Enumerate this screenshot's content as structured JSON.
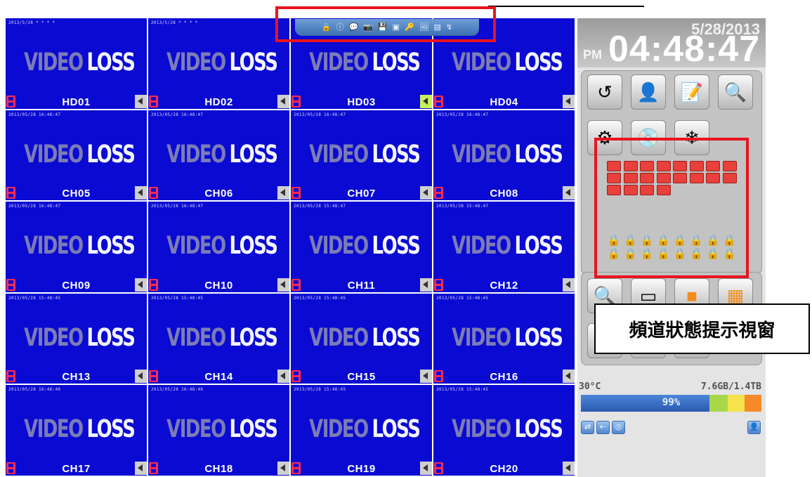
{
  "tiles": [
    {
      "ts": "2013/5/28 * * * *",
      "ch": "HD01",
      "spk": "normal"
    },
    {
      "ts": "2013/5/28 * * * *",
      "ch": "HD02",
      "spk": "normal"
    },
    {
      "ts": "",
      "ch": "HD03",
      "spk": "active"
    },
    {
      "ts": "",
      "ch": "HD04",
      "spk": "normal"
    },
    {
      "ts": "2013/05/28 16:48:47",
      "ch": "CH05",
      "spk": "normal"
    },
    {
      "ts": "2013/05/28 16:48:47",
      "ch": "CH06",
      "spk": "normal"
    },
    {
      "ts": "2013/05/28 16:48:47",
      "ch": "CH07",
      "spk": "normal"
    },
    {
      "ts": "2013/05/28 16:48:47",
      "ch": "CH08",
      "spk": "normal"
    },
    {
      "ts": "2013/05/28 16:48:47",
      "ch": "CH09",
      "spk": "normal"
    },
    {
      "ts": "2013/05/28 16:48:47",
      "ch": "CH10",
      "spk": "normal"
    },
    {
      "ts": "2013/05/28 15:48:47",
      "ch": "CH11",
      "spk": "normal"
    },
    {
      "ts": "2013/05/28 15:48:47",
      "ch": "CH12",
      "spk": "normal"
    },
    {
      "ts": "2013/05/28 15:48:45",
      "ch": "CH13",
      "spk": "normal"
    },
    {
      "ts": "2013/05/28 15:48:45",
      "ch": "CH14",
      "spk": "normal"
    },
    {
      "ts": "2013/05/28 15:48:45",
      "ch": "CH15",
      "spk": "normal"
    },
    {
      "ts": "2013/05/28 15:48:45",
      "ch": "CH16",
      "spk": "normal"
    },
    {
      "ts": "2013/05/28 16:48:46",
      "ch": "CH17",
      "spk": "normal"
    },
    {
      "ts": "2013/05/28 16:48:46",
      "ch": "CH18",
      "spk": "normal"
    },
    {
      "ts": "2013/05/28 15:48:45",
      "ch": "CH19",
      "spk": "normal"
    },
    {
      "ts": "2013/05/28 15:48:45",
      "ch": "CH20",
      "spk": "normal"
    }
  ],
  "video_loss": {
    "video": "VIDEO",
    "loss": "LOSS"
  },
  "toolbar_icons": [
    "lock-icon",
    "info-icon",
    "chat-icon",
    "camera-icon",
    "floppy-icon",
    "media-icon",
    "key-icon",
    "image-icon",
    "hdd-icon",
    "network-icon"
  ],
  "clock": {
    "date": "5/28/2013",
    "ampm": "PM",
    "time": "04:48:47"
  },
  "menu_icons": [
    "backup-icon",
    "search-person-icon",
    "log-icon",
    "playback-search-icon",
    "config-icon",
    "disk-icon",
    "snowflake-icon"
  ],
  "status_counts": {
    "network_icons": 20,
    "lock_icons": 16
  },
  "view_icons": [
    "zoom-icon",
    "single-view-icon",
    "full-view-icon",
    "quad-view-icon"
  ],
  "callout_text": "頻道狀態提示視窗",
  "temperature": "30°C",
  "storage": "7.6GB/1.4TB",
  "usage_percent": "99%",
  "usage_fraction": 0.99,
  "bottom_icons": [
    "network-status-icon",
    "usb-icon",
    "dvd-icon",
    "user-icon"
  ],
  "colors": {
    "tile_bg": "#0a0ad2",
    "highlight": "#e8141e",
    "bar_blue": "#2a5ab0",
    "bar_orange": "#f48a2a"
  }
}
